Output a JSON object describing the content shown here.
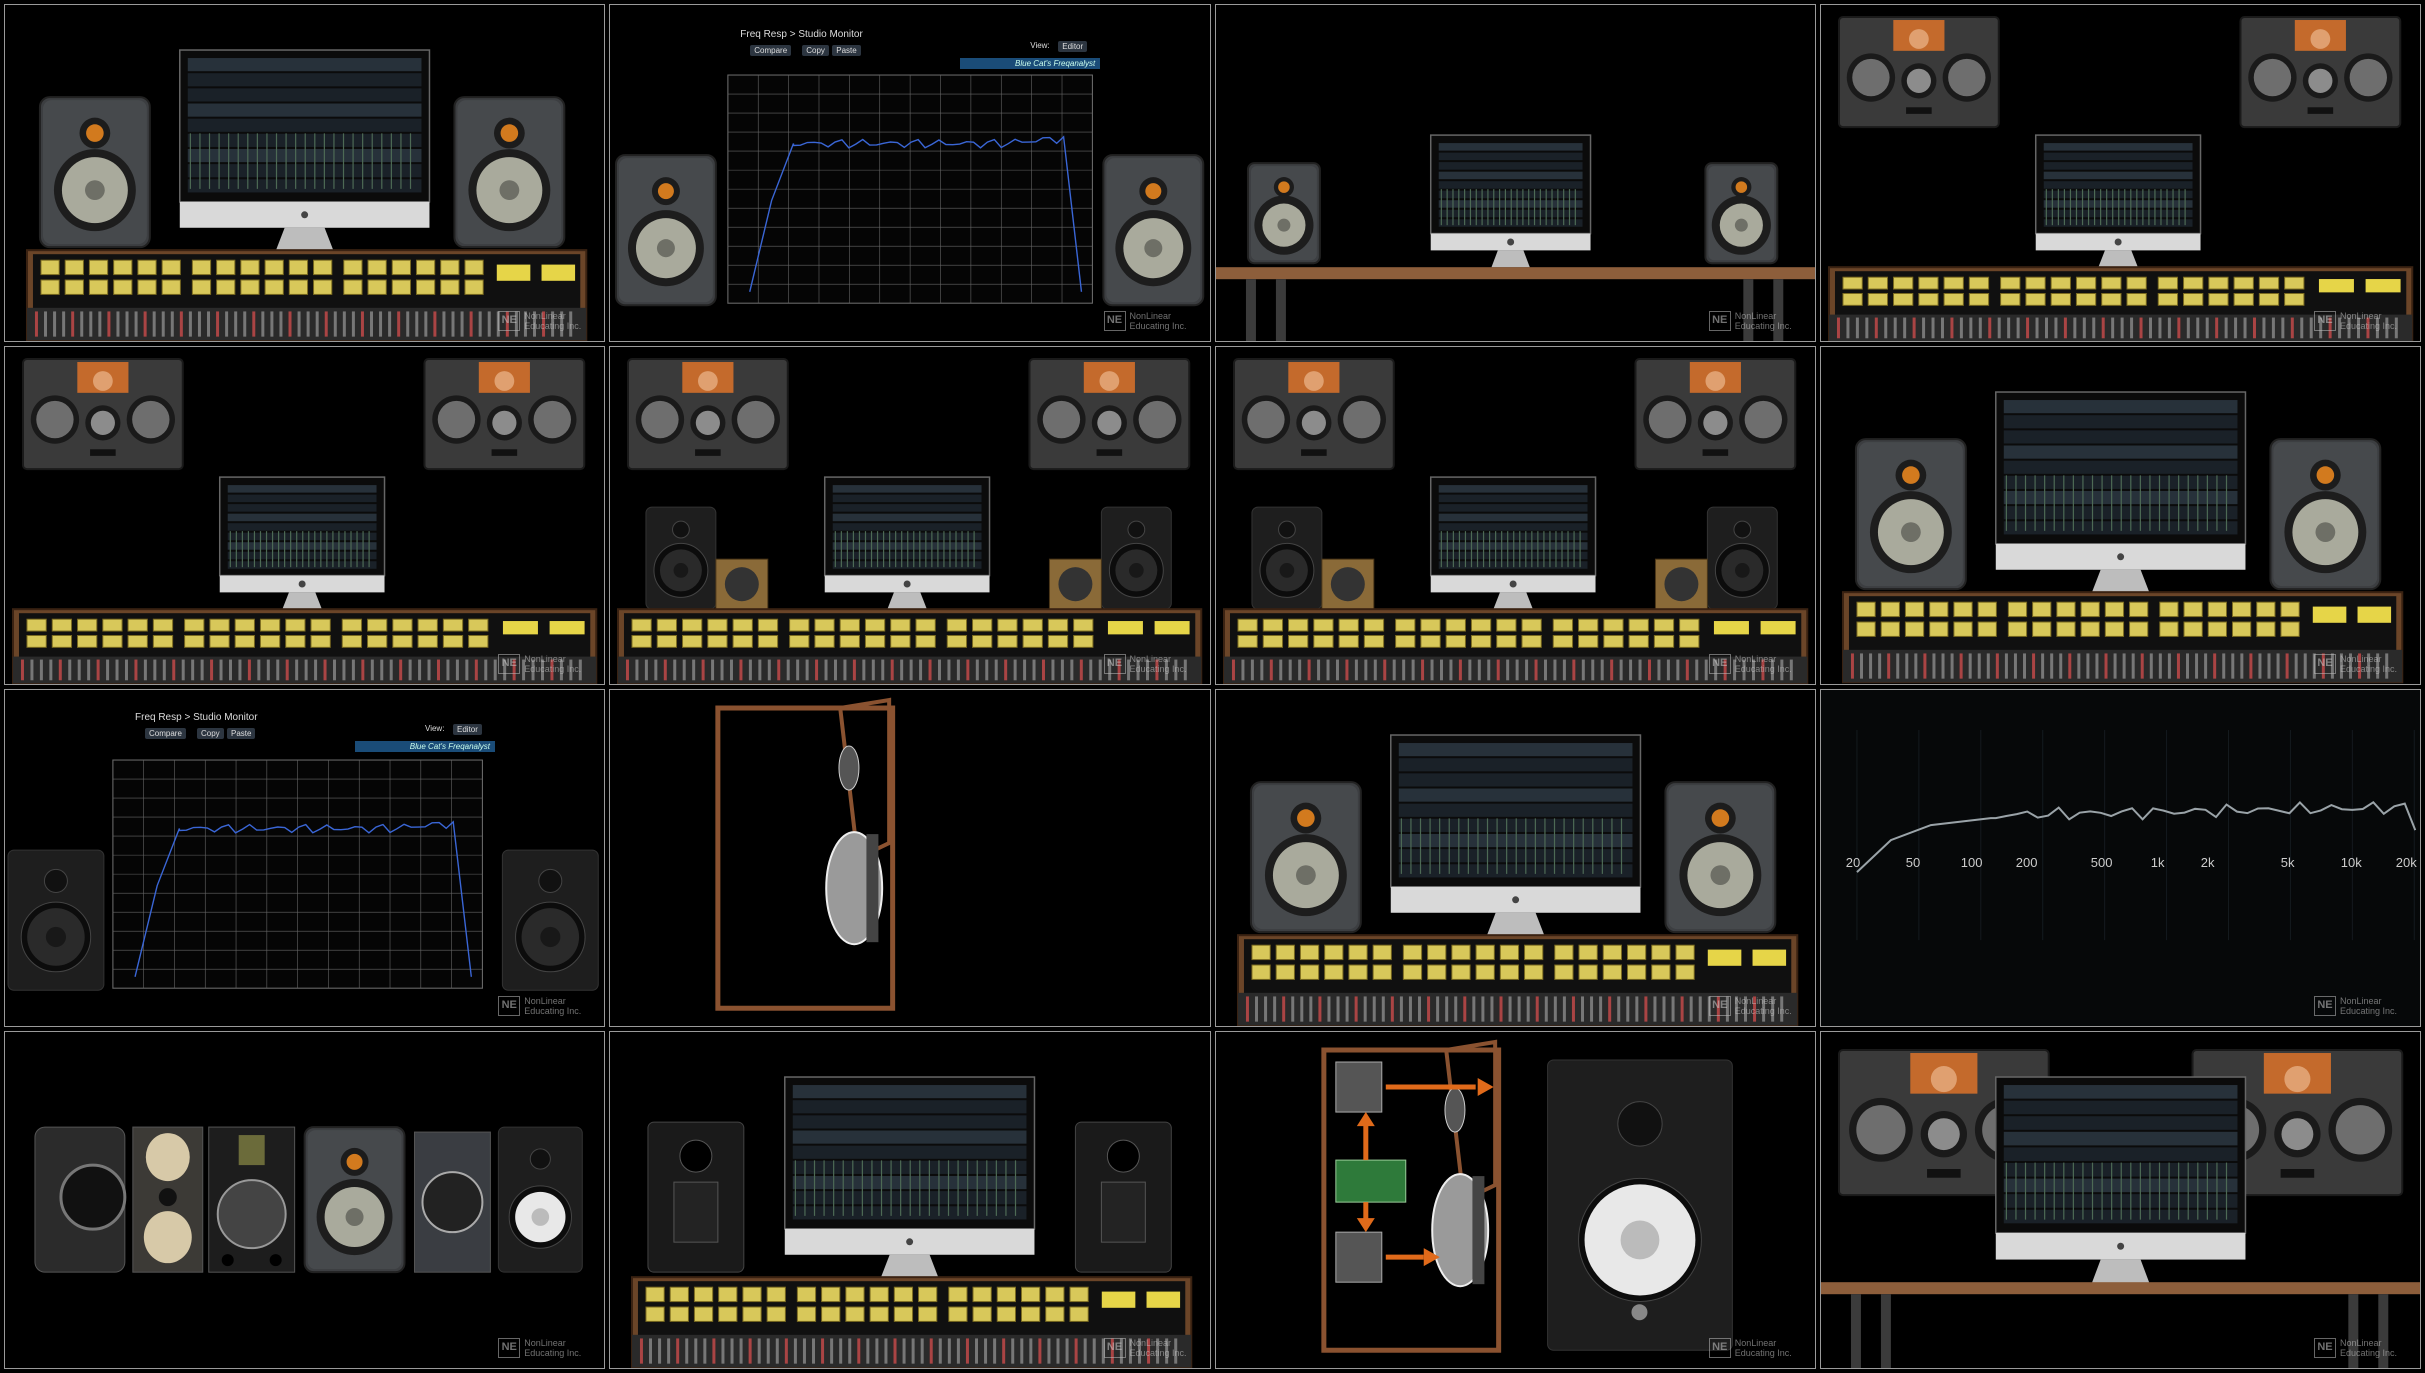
{
  "watermark": {
    "logo": "NE",
    "line1": "NonLinear",
    "line2": "Educating Inc."
  },
  "analyzer": {
    "title": "Freq Resp > Studio Monitor",
    "buttons": [
      "Compare",
      "Copy",
      "Paste"
    ],
    "view_label": "View:",
    "view_value": "Editor",
    "preset": "Blue Cat's Freqanalyst"
  },
  "freq_axis": [
    "20",
    "50",
    "100",
    "200",
    "500",
    "1k",
    "2k",
    "5k",
    "10k",
    "20k"
  ],
  "tiles": [
    {
      "scene": "studio-console"
    },
    {
      "scene": "analyzer-monitors"
    },
    {
      "scene": "desk-small-monitors"
    },
    {
      "scene": "mains-console"
    },
    {
      "scene": "mains-console"
    },
    {
      "scene": "mains-nearfields"
    },
    {
      "scene": "mains-nearfields"
    },
    {
      "scene": "studio-console"
    },
    {
      "scene": "analyzer-monitors-2"
    },
    {
      "scene": "cabinet-diagram"
    },
    {
      "scene": "studio-console-2"
    },
    {
      "scene": "freq-curve"
    },
    {
      "scene": "speaker-lineup"
    },
    {
      "scene": "rear-monitors"
    },
    {
      "scene": "signal-flow"
    },
    {
      "scene": "mains-desk"
    }
  ]
}
